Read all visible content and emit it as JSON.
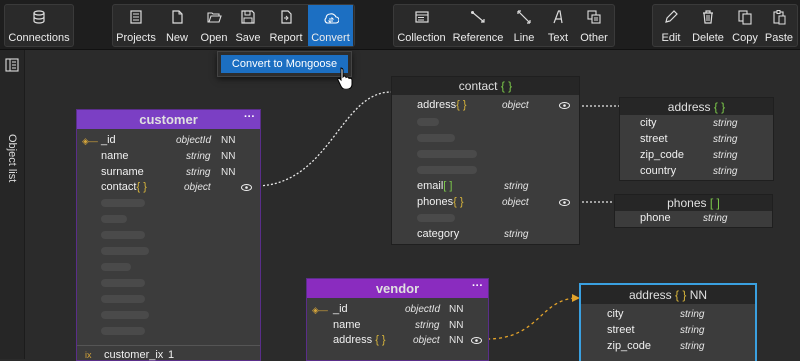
{
  "toolbar": {
    "connections": "Connections",
    "projects": "Projects",
    "new": "New",
    "open": "Open",
    "save": "Save",
    "report": "Report",
    "convert": "Convert",
    "collection": "Collection",
    "reference": "Reference",
    "line": "Line",
    "text": "Text",
    "other": "Other",
    "edit": "Edit",
    "delete": "Delete",
    "copy": "Copy",
    "paste": "Paste"
  },
  "dropdown": {
    "item": "Convert to Mongoose"
  },
  "sidebar": {
    "label": "Object list"
  },
  "colors": {
    "accent": "#1c6fc2",
    "entity_header": "#7b3fc4",
    "vendor_header": "#8a2cbf",
    "selected_border": "#3aa0e0",
    "dotted_link": "#e3a32a"
  },
  "customer": {
    "title": "customer",
    "menu": "···",
    "fields": [
      {
        "name": "_id",
        "type": "objectId",
        "nn": "NN"
      },
      {
        "name": "name",
        "type": "string",
        "nn": "NN"
      },
      {
        "name": "surname",
        "type": "string",
        "nn": "NN"
      },
      {
        "name": "contact",
        "bracket": "{ }",
        "type": "object"
      }
    ],
    "index_prefix": "ix",
    "index": "customer_ix",
    "index_num": "1"
  },
  "contact": {
    "title": "contact",
    "bracket": "{ }",
    "fields": [
      {
        "name": "address",
        "bracket": "{ }",
        "type": "object"
      },
      {
        "name": "email",
        "bracket": "[ ]",
        "type": "string"
      },
      {
        "name": "phones",
        "bracket": "{ }",
        "type": "object"
      },
      {
        "name": "category",
        "type": "string"
      }
    ]
  },
  "address1": {
    "title": "address",
    "bracket": "{ }",
    "fields": [
      {
        "name": "city",
        "type": "string"
      },
      {
        "name": "street",
        "type": "string"
      },
      {
        "name": "zip_code",
        "type": "string"
      },
      {
        "name": "country",
        "type": "string"
      }
    ]
  },
  "phones": {
    "title": "phones",
    "bracket": "[ ]",
    "fields": [
      {
        "name": "phone",
        "type": "string"
      }
    ]
  },
  "vendor": {
    "title": "vendor",
    "menu": "···",
    "fields": [
      {
        "name": "_id",
        "type": "objectId",
        "nn": "NN"
      },
      {
        "name": "name",
        "type": "string",
        "nn": "NN"
      },
      {
        "name": "address",
        "bracket": "{ }",
        "type": "object",
        "nn": "NN"
      }
    ]
  },
  "address2": {
    "title": "address",
    "bracket": "{ }",
    "nn": "NN",
    "fields": [
      {
        "name": "city",
        "type": "string"
      },
      {
        "name": "street",
        "type": "string"
      },
      {
        "name": "zip_code",
        "type": "string"
      }
    ]
  }
}
